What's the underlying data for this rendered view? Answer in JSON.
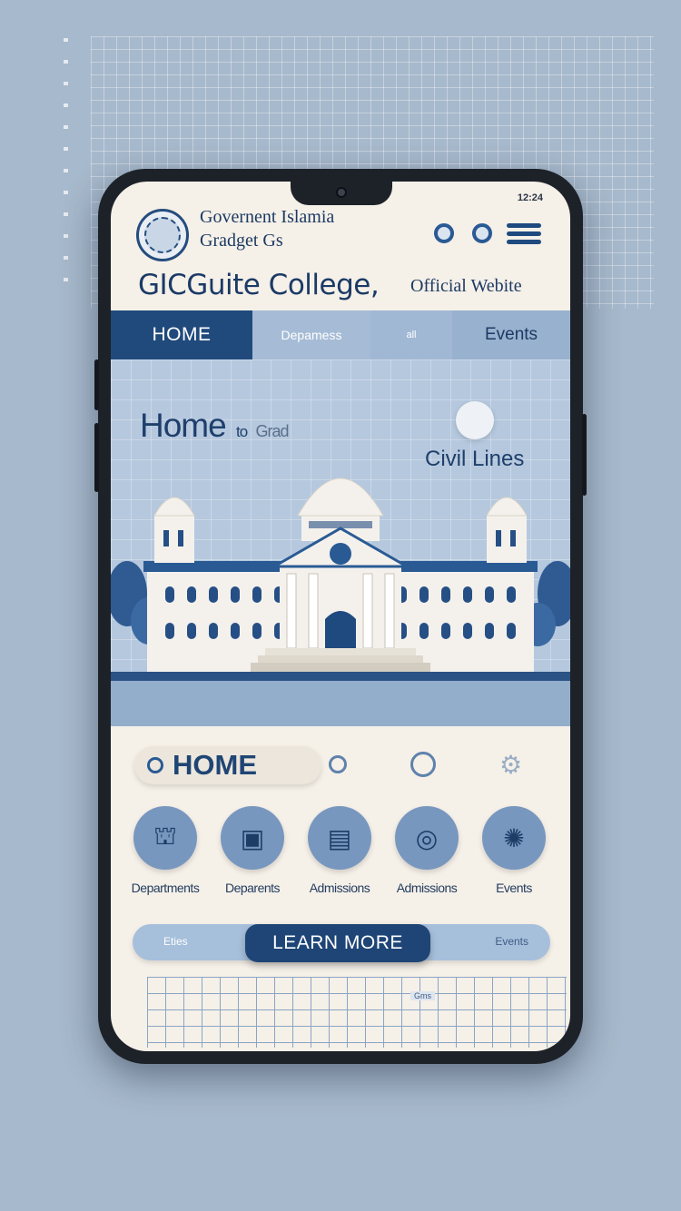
{
  "header": {
    "status_time": "12:24",
    "line1": "Governent Islamia",
    "line2": "Gradget Gs",
    "title": "GICGuite College,",
    "subtitle": "Official Webite"
  },
  "nav": {
    "items": [
      {
        "label": "HOME"
      },
      {
        "label": "Depamess"
      },
      {
        "label": "all"
      },
      {
        "label": "Events"
      }
    ]
  },
  "hero": {
    "title": "Home",
    "title_small": "to",
    "title_faint": "Grad",
    "location": "Civil Lines"
  },
  "quicknav": {
    "home_label": "HOME"
  },
  "cards": [
    {
      "label": "Departments",
      "icon": "university-icon"
    },
    {
      "label": "Deparents",
      "icon": "monitor-icon"
    },
    {
      "label": "Admissions",
      "icon": "form-icon"
    },
    {
      "label": "Admissions",
      "icon": "globe-icon"
    },
    {
      "label": "Events",
      "icon": "sun-icon"
    }
  ],
  "actions": {
    "left_label": "Eties",
    "cta_label": "LEARN MORE",
    "right_label": "Events"
  },
  "footer": {
    "label": "Gms"
  },
  "colors": {
    "primary": "#204a7c",
    "background": "#a7b9cc",
    "screen": "#f5f0e8"
  }
}
